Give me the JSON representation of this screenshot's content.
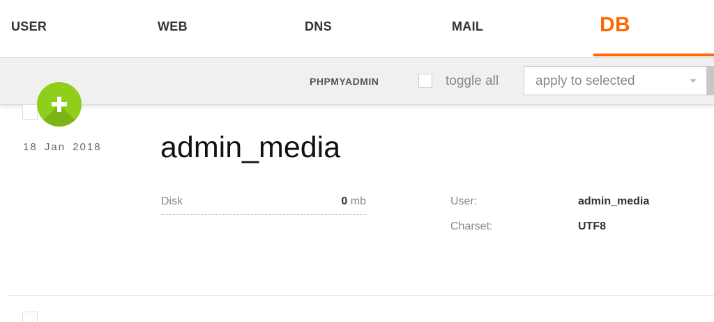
{
  "nav": {
    "items": [
      {
        "label": "USER"
      },
      {
        "label": "WEB"
      },
      {
        "label": "DNS"
      },
      {
        "label": "MAIL"
      },
      {
        "label": "DB"
      }
    ],
    "active": "DB",
    "accent_color": "#ff6701"
  },
  "toolbar": {
    "phpmyadmin_label": "PHPMYADMIN",
    "toggle_all_label": "toggle all",
    "bulk_action_value": "apply to selected"
  },
  "add_button": {
    "icon": "plus-icon",
    "color": "#8fcf1a"
  },
  "databases": [
    {
      "date": "18 Jan 2018",
      "name": "admin_media",
      "disk_label": "Disk",
      "disk_value": "0",
      "disk_unit": "mb",
      "user_label": "User:",
      "user_value": "admin_media",
      "charset_label": "Charset:",
      "charset_value": "UTF8"
    }
  ]
}
